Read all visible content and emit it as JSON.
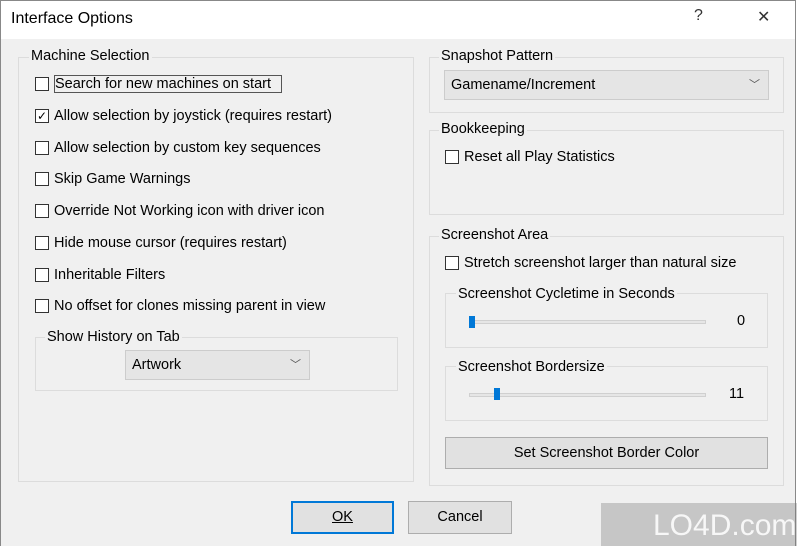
{
  "window": {
    "title": "Interface Options",
    "help": "?",
    "close": "✕"
  },
  "machine_selection": {
    "label": "Machine Selection",
    "options": [
      {
        "label": "Search for new machines on start",
        "checked": false
      },
      {
        "label": "Allow selection by joystick (requires restart)",
        "checked": true
      },
      {
        "label": "Allow selection by custom key sequences",
        "checked": false
      },
      {
        "label": "Skip Game Warnings",
        "checked": false
      },
      {
        "label": "Override Not Working icon with driver icon",
        "checked": false
      },
      {
        "label": "Hide mouse cursor (requires restart)",
        "checked": false
      },
      {
        "label": "Inheritable Filters",
        "checked": false
      },
      {
        "label": "No offset for clones missing parent in view",
        "checked": false
      }
    ],
    "history": {
      "label": "Show History on Tab",
      "value": "Artwork"
    }
  },
  "snapshot": {
    "label": "Snapshot Pattern",
    "value": "Gamename/Increment"
  },
  "bookkeeping": {
    "label": "Bookkeeping",
    "reset": {
      "label": "Reset all Play Statistics",
      "checked": false
    }
  },
  "screenshot": {
    "label": "Screenshot Area",
    "stretch": {
      "label": "Stretch screenshot larger than natural size",
      "checked": false
    },
    "cycletime": {
      "label": "Screenshot Cycletime in Seconds",
      "value": "0"
    },
    "bordersize": {
      "label": "Screenshot Bordersize",
      "value": "11"
    },
    "color_button": "Set Screenshot Border Color"
  },
  "buttons": {
    "ok": "OK",
    "cancel": "Cancel"
  },
  "watermark": "LO4D.com",
  "colors": {
    "accent": "#0078d7"
  }
}
